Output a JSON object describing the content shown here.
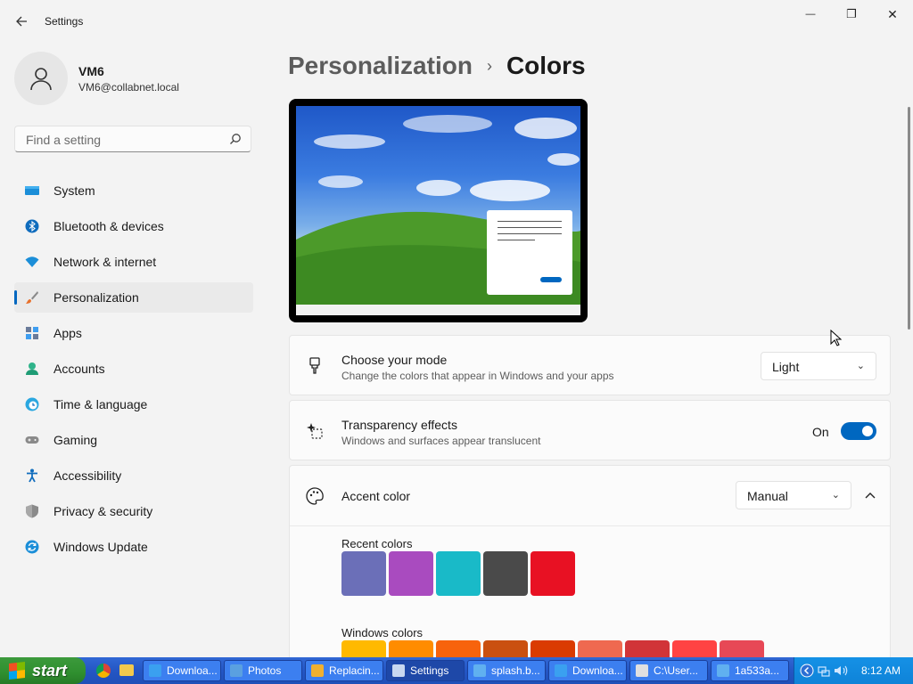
{
  "window": {
    "title": "Settings",
    "minimize_glyph": "—",
    "maximize_glyph": "❐",
    "close_glyph": "✕"
  },
  "profile": {
    "name": "VM6",
    "email": "VM6@collabnet.local"
  },
  "search": {
    "placeholder": "Find a setting"
  },
  "nav": {
    "items": [
      {
        "label": "System",
        "icon": "monitor-icon"
      },
      {
        "label": "Bluetooth & devices",
        "icon": "bluetooth-icon"
      },
      {
        "label": "Network & internet",
        "icon": "wifi-icon"
      },
      {
        "label": "Personalization",
        "icon": "brush-icon",
        "active": true
      },
      {
        "label": "Apps",
        "icon": "apps-icon"
      },
      {
        "label": "Accounts",
        "icon": "person-icon"
      },
      {
        "label": "Time & language",
        "icon": "globe-clock-icon"
      },
      {
        "label": "Gaming",
        "icon": "gamepad-icon"
      },
      {
        "label": "Accessibility",
        "icon": "accessibility-icon"
      },
      {
        "label": "Privacy & security",
        "icon": "shield-icon"
      },
      {
        "label": "Windows Update",
        "icon": "update-icon"
      }
    ]
  },
  "header": {
    "parent": "Personalization",
    "separator": "›",
    "current": "Colors"
  },
  "mode_card": {
    "title": "Choose your mode",
    "subtitle": "Change the colors that appear in Windows and your apps",
    "value": "Light"
  },
  "transparency_card": {
    "title": "Transparency effects",
    "subtitle": "Windows and surfaces appear translucent",
    "state_label": "On",
    "on": true
  },
  "accent_card": {
    "title": "Accent color",
    "value": "Manual",
    "recent_label": "Recent colors",
    "recent_colors": [
      "#6b6fb8",
      "#a94bbf",
      "#19bac8",
      "#4a4a4a",
      "#e81123"
    ],
    "windows_label": "Windows colors",
    "windows_colors": [
      "#ffb900",
      "#ff8c00",
      "#f7630c",
      "#ca5010",
      "#da3b01",
      "#ef6950",
      "#d13438",
      "#ff4343",
      "#e74856"
    ]
  },
  "taskbar": {
    "start_label": "start",
    "tasks": [
      {
        "label": "Downloa..."
      },
      {
        "label": "Photos"
      },
      {
        "label": "Replacin..."
      },
      {
        "label": "Settings",
        "active": true
      },
      {
        "label": "splash.b..."
      },
      {
        "label": "Downloa..."
      },
      {
        "label": "C:\\User..."
      },
      {
        "label": "1a533a..."
      }
    ],
    "time": "8:12 AM"
  },
  "colors": {
    "accent": "#0067c0",
    "taskbar": "#2456c4",
    "start": "#2f8f2f"
  }
}
